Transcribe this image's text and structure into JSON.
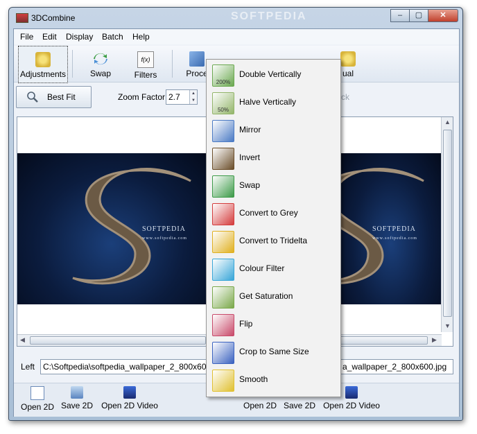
{
  "window": {
    "title": "3DCombine",
    "minimize": "–",
    "maximize": "▢",
    "close": "✕"
  },
  "menu": [
    "File",
    "Edit",
    "Display",
    "Batch",
    "Help"
  ],
  "toolbar": {
    "adjustments": "Adjustments",
    "swap": "Swap",
    "filters": "Filters",
    "filters_icon_text": "f(x)",
    "process": "Proce",
    "visual": "ual"
  },
  "viewbar": {
    "best_fit": "Best Fit",
    "zoom_label": "Zoom Factor",
    "zoom_value": "2.7",
    "right_tail": "ck"
  },
  "view": {
    "image_word": "SOFTPEDIA",
    "image_url": "www.softpedia.com"
  },
  "paths": {
    "left_label": "Left",
    "left_path": "C:\\Softpedia\\softpedia_wallpaper_2_800x600.jpg",
    "right_path": "a_wallpaper_2_800x600.jpg"
  },
  "bottom": {
    "left": [
      "Open 2D",
      "Save 2D",
      "Open 2D Video"
    ],
    "right": [
      "Open 2D",
      "Save 2D",
      "Open 2D Video"
    ]
  },
  "dropdown": {
    "items": [
      {
        "label": "Double Vertically",
        "icon": "double-vertically-icon",
        "badge": "200%",
        "color": "#6aa84f"
      },
      {
        "label": "Halve Vertically",
        "icon": "halve-vertically-icon",
        "badge": "50%",
        "color": "#93b56a"
      },
      {
        "label": "Mirror",
        "icon": "mirror-icon",
        "color": "#4a7ac4"
      },
      {
        "label": "Invert",
        "icon": "invert-icon",
        "color": "#6b4e2a"
      },
      {
        "label": "Swap",
        "icon": "swap-icon",
        "color": "#3c9a48"
      },
      {
        "label": "Convert to Grey",
        "icon": "convert-to-grey-icon",
        "color": "#d43c3c"
      },
      {
        "label": "Convert to Tridelta",
        "icon": "convert-to-tridelta-icon",
        "color": "#e0b020"
      },
      {
        "label": "Colour Filter",
        "icon": "colour-filter-icon",
        "color": "#38a6d8"
      },
      {
        "label": "Get Saturation",
        "icon": "get-saturation-icon",
        "color": "#7aa84a"
      },
      {
        "label": "Flip",
        "icon": "flip-icon",
        "color": "#c84a6a"
      },
      {
        "label": "Crop to Same Size",
        "icon": "crop-to-same-size-icon",
        "color": "#3a62c0"
      },
      {
        "label": "Smooth",
        "icon": "smooth-icon",
        "color": "#e0c030"
      }
    ]
  },
  "watermark": "SOFTPEDIA"
}
